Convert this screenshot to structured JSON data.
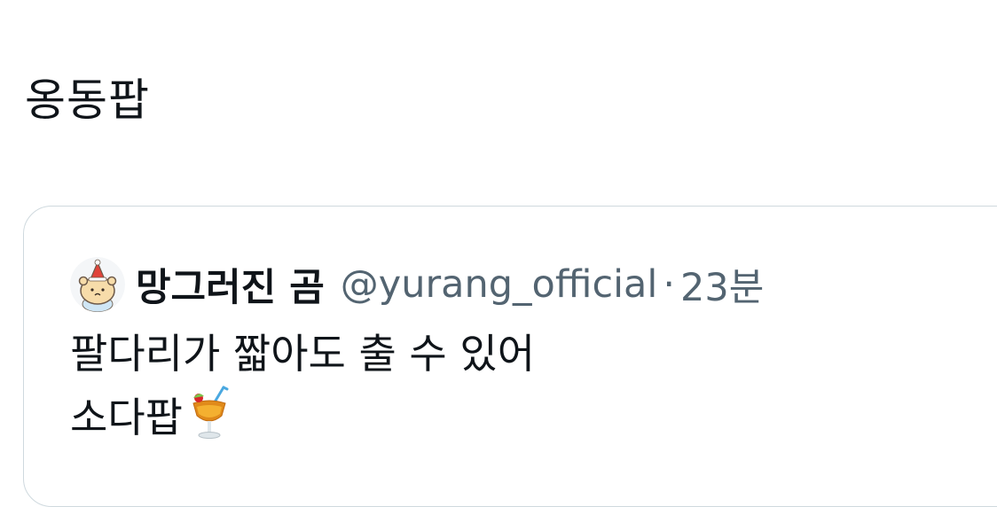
{
  "tweet": {
    "text": "옹동팝"
  },
  "quoted_tweet": {
    "display_name": "망그러진 곰",
    "handle": "@yurang_official",
    "separator": "·",
    "time": "23분",
    "lines": [
      "팔다리가 짧아도 출 수 있어",
      "소다팝"
    ],
    "emoji": "tropical-drink"
  }
}
